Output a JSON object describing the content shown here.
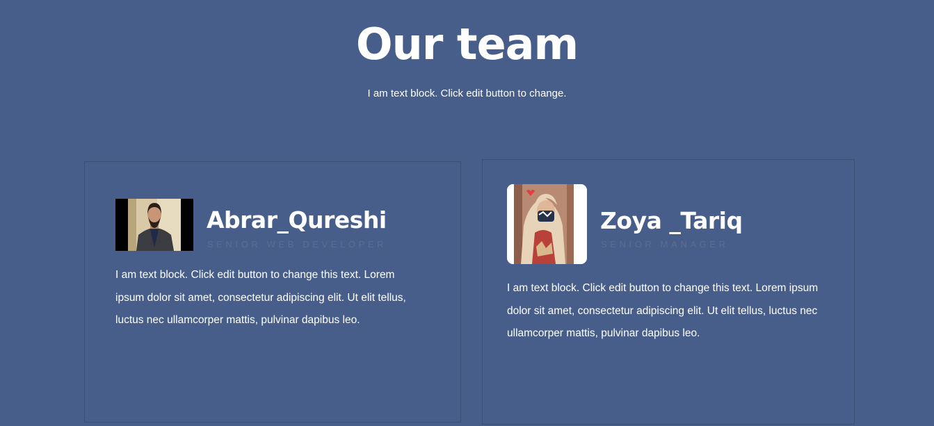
{
  "section": {
    "title": "Our team",
    "subtitle": "I am text block. Click edit button to change."
  },
  "members": [
    {
      "name": "Abrar_Qureshi",
      "role": "Senior Web Developer",
      "bio": "I am text block. Click edit button to change this text. Lorem ipsum dolor sit amet, consectetur adipiscing elit. Ut elit tellus, luctus nec ullamcorper mattis, pulvinar dapibus leo.",
      "photo_icon": "person-photo"
    },
    {
      "name": "Zoya _Tariq",
      "role": "Senior Manager",
      "bio": "I am text block. Click edit button to change this text. Lorem ipsum dolor sit amet, consectetur adipiscing elit. Ut elit tellus, luctus nec ullamcorper mattis, pulvinar dapibus leo.",
      "photo_icon": "person-photo"
    }
  ],
  "colors": {
    "background": "#485e8a",
    "text": "#ffffff",
    "role_text": "#5b6d8f",
    "card_border": "#3b4f75"
  }
}
